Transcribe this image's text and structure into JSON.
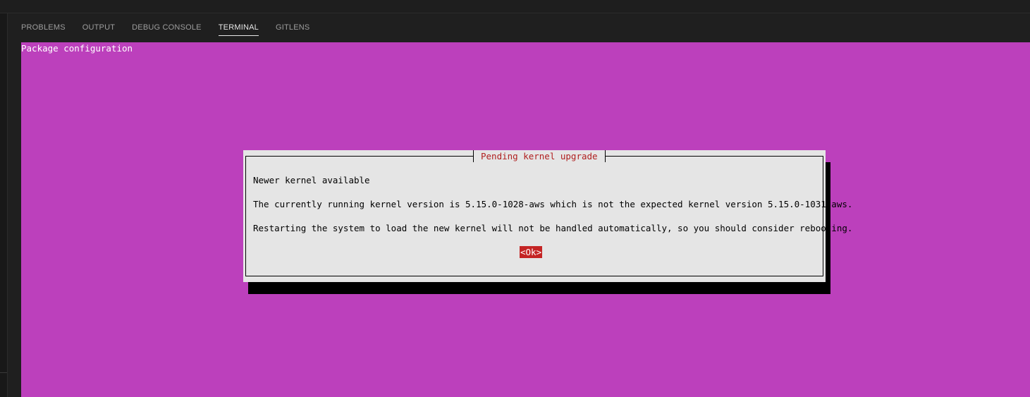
{
  "panel": {
    "tabs": [
      {
        "label": "PROBLEMS",
        "active": false
      },
      {
        "label": "OUTPUT",
        "active": false
      },
      {
        "label": "DEBUG CONSOLE",
        "active": false
      },
      {
        "label": "TERMINAL",
        "active": true
      },
      {
        "label": "GITLENS",
        "active": false
      }
    ]
  },
  "terminal": {
    "background": "#bc40bc",
    "title": "Package configuration",
    "dialog": {
      "title": "Pending kernel upgrade",
      "heading": "Newer kernel available",
      "line1": "The currently running kernel version is 5.15.0-1028-aws which is not the expected kernel version 5.15.0-1031-aws.",
      "line2": "Restarting the system to load the new kernel will not be handled automatically, so you should consider rebooting.",
      "ok_label": "<Ok>"
    }
  }
}
